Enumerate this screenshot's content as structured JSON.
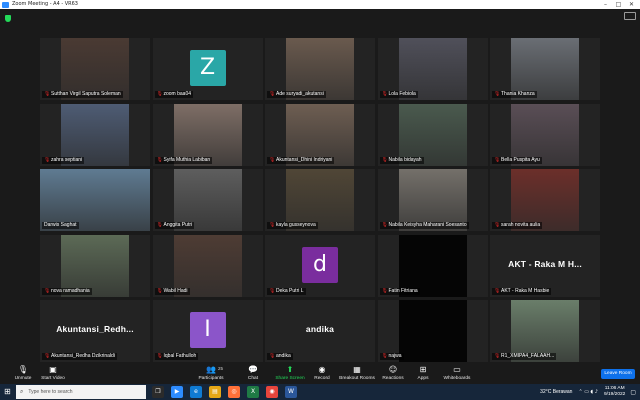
{
  "window": {
    "title": "Zoom Meeting - A4 - VR63",
    "controls": [
      "–",
      "□",
      "✕"
    ]
  },
  "participants": [
    {
      "name": "Sutthan Virgil Saputra Soleman",
      "kind": "video",
      "bg": "#4a3a33",
      "muted": true
    },
    {
      "name": "zoom baa04",
      "kind": "avatar",
      "letter": "Z",
      "avatar_color": "#2aa7a7",
      "muted": true
    },
    {
      "name": "Ade suryadi_akutansi",
      "kind": "video",
      "bg": "#6a5a4e",
      "muted": true
    },
    {
      "name": "Lola Febiola",
      "kind": "video",
      "bg": "#50505a",
      "muted": true
    },
    {
      "name": "Thania Khanza",
      "kind": "video",
      "bg": "#6a6e74",
      "muted": true
    },
    {
      "name": "zahra septiani",
      "kind": "video",
      "bg": "#4e5c74",
      "muted": true
    },
    {
      "name": "Syifa Muthia Labiban",
      "kind": "video",
      "bg": "#7e6e66",
      "muted": true
    },
    {
      "name": "Akuntansi_Dhini Indriyani",
      "kind": "video",
      "bg": "#6e5e52",
      "muted": true
    },
    {
      "name": "Nabila bidayah",
      "kind": "video",
      "bg": "#4a5a4e",
      "muted": true
    },
    {
      "name": "Bella Puspita Ayu",
      "kind": "video",
      "bg": "#5a4e56",
      "muted": true
    },
    {
      "name": "Darwis Saghat",
      "kind": "video",
      "bg": "#5f7b92",
      "muted": false,
      "active": true
    },
    {
      "name": "Anggita Putri",
      "kind": "video",
      "bg": "#5e5e5e",
      "muted": true
    },
    {
      "name": "kayla gusseynova",
      "kind": "video",
      "bg": "#504636",
      "muted": true
    },
    {
      "name": "Nabila Keisyha Maharani Soesanto",
      "kind": "video",
      "bg": "#74706a",
      "muted": true
    },
    {
      "name": "sarah novita aulia",
      "kind": "video",
      "bg": "#6c2f2a",
      "muted": true
    },
    {
      "name": "nova ramadhania",
      "kind": "video",
      "bg": "#5c6a56",
      "muted": true
    },
    {
      "name": "Wabil Hadi",
      "kind": "video",
      "bg": "#4e3c34",
      "muted": true
    },
    {
      "name": "Deka Putri L",
      "kind": "avatar",
      "letter": "d",
      "avatar_color": "#7a2d9e",
      "muted": true
    },
    {
      "name": "Fatin Fitriana",
      "kind": "dark",
      "muted": true
    },
    {
      "name": "AKT - Raka M Hasbie",
      "kind": "text",
      "display": "AKT - Raka M H...",
      "muted": true
    },
    {
      "name": "Akuntansi_Redha Dzikrinaldi",
      "kind": "text",
      "display": "Akuntansi_Redh...",
      "muted": true
    },
    {
      "name": "Iqbal Fathulloh",
      "kind": "avatar",
      "letter": "I",
      "avatar_color": "#8b55c9",
      "muted": true
    },
    {
      "name": "andika",
      "kind": "text",
      "display": "andika",
      "muted": true
    },
    {
      "name": "najwa",
      "kind": "dark",
      "muted": true
    },
    {
      "name": "R1_XMIPA4_FALAAH...",
      "kind": "video",
      "bg": "#6a7e6a",
      "muted": true
    }
  ],
  "toolbar": {
    "unmute": "Unmute",
    "start_video": "Start Video",
    "participants": "Participants",
    "participants_count": "25",
    "chat": "Chat",
    "share_screen": "Share Screen",
    "record": "Record",
    "breakout_rooms": "Breakout Rooms",
    "reactions": "Reactions",
    "apps": "Apps",
    "whiteboards": "Whiteboards",
    "leave": "Leave Room"
  },
  "taskbar": {
    "search_placeholder": "Type here to search",
    "weather": "32°C  Berawan",
    "time": "11:06 AM",
    "date": "9/19/2022"
  },
  "colors": {
    "meeting_bg": "#1a1a1a",
    "tile_bg": "#232323",
    "active_border": "#f4e94d",
    "leave_button": "#0e71eb",
    "share_green": "#23d959",
    "taskbar": "#16263a"
  }
}
